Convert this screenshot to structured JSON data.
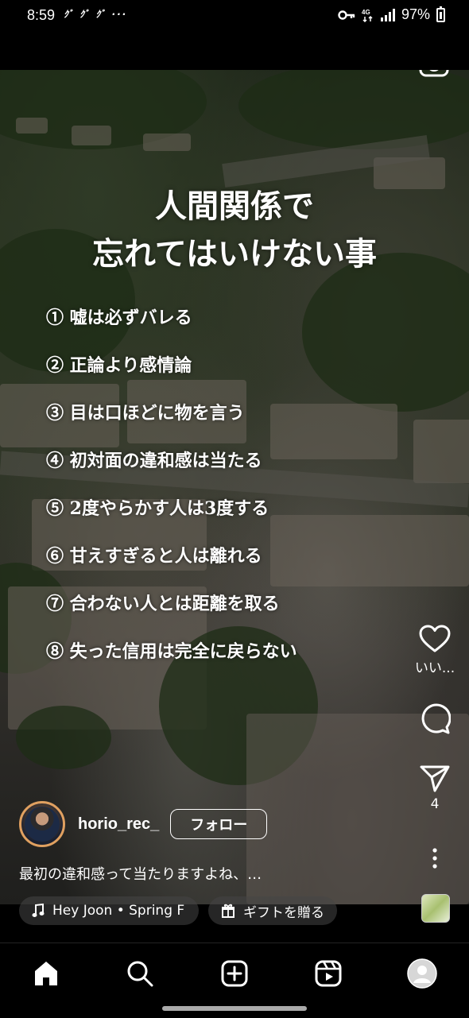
{
  "status_bar": {
    "time": "8:59",
    "notifications": "ｸﾞ ｸﾞ ｸﾞ  ···",
    "battery": "97%"
  },
  "reel": {
    "title_line1": "人間関係で",
    "title_line2": "忘れてはいけない事",
    "items": [
      "① 嘘は必ずバレる",
      "② 正論より感情論",
      "③ 目は口ほどに物を言う",
      "④ 初対面の違和感は当たる",
      "⑤ 2度やらかす人は3度する",
      "⑥ 甘えすぎると人は離れる",
      "⑦ 合わない人とは距離を取る",
      "⑧ 失った信用は完全に戻らない"
    ]
  },
  "actions": {
    "like_label": "いい...",
    "share_count": "4"
  },
  "user": {
    "username": "horio_rec_",
    "follow_label": "フォロー",
    "caption": "最初の違和感って当たりますよね、…"
  },
  "chips": {
    "music": "Hey Joon • Spring F",
    "gift": "ギフトを贈る"
  },
  "colors": {
    "background": "#000000",
    "text": "#ffffff",
    "avatar_ring": "#e0a060"
  },
  "icons": [
    "key-icon",
    "4g-icon",
    "signal-icon",
    "battery-icon",
    "camera-icon",
    "heart-icon",
    "comment-icon",
    "send-icon",
    "more-icon",
    "music-note-icon",
    "gift-icon",
    "home-icon",
    "search-icon",
    "create-icon",
    "reels-icon",
    "profile-icon"
  ]
}
